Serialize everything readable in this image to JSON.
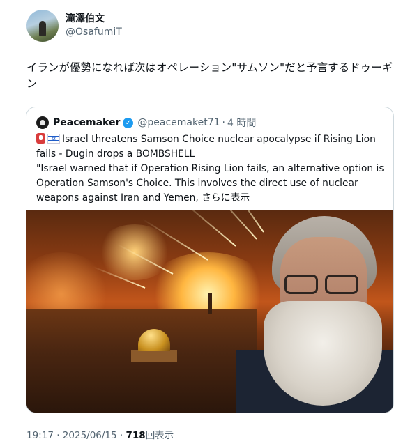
{
  "author": {
    "display_name": "滝澤伯文",
    "handle": "@OsafumiT"
  },
  "tweet": {
    "text": "イランが優勢になれば次はオペレーション\"サムソン\"だと予言するドゥーギン"
  },
  "quoted": {
    "display_name": "Peacemaker",
    "handle": "@peacemaket71",
    "separator": "·",
    "time_ago": "4 時間",
    "text_line1": "Israel threatens Samson Choice nuclear apocalypse if Rising Lion fails - Dugin drops a BOMBSHELL",
    "text_line2": "\"Israel warned that if Operation Rising Lion fails, an alternative option is Operation Samson's Choice. This involves the direct use of nuclear weapons against Iran and Yemen,",
    "show_more": "さらに表示",
    "emoji_icons": [
      "siren-icon",
      "israel-flag-icon"
    ]
  },
  "footer": {
    "time": "19:17",
    "separator": "·",
    "date": "2025/06/15",
    "views_count": "718",
    "views_label": "回表示"
  },
  "colors": {
    "text": "#0f1419",
    "secondary": "#536471",
    "border": "#cfd9de",
    "verified": "#1d9bf0"
  }
}
